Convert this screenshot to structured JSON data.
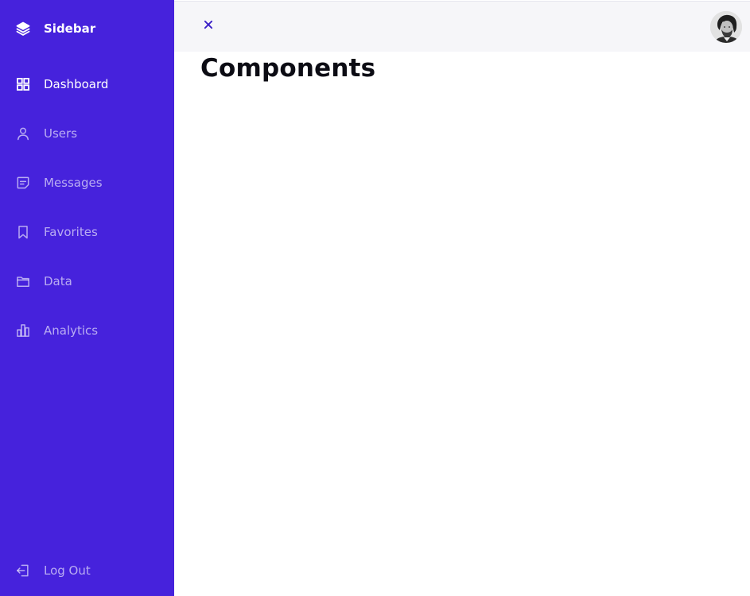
{
  "sidebar": {
    "brand": {
      "label": "Sidebar",
      "icon": "layers-icon"
    },
    "items": [
      {
        "label": "Dashboard",
        "icon": "grid-icon",
        "active": true
      },
      {
        "label": "Users",
        "icon": "user-icon",
        "active": false
      },
      {
        "label": "Messages",
        "icon": "message-icon",
        "active": false
      },
      {
        "label": "Favorites",
        "icon": "bookmark-icon",
        "active": false
      },
      {
        "label": "Data",
        "icon": "folder-icon",
        "active": false
      },
      {
        "label": "Analytics",
        "icon": "bar-chart-icon",
        "active": false
      }
    ],
    "logout": {
      "label": "Log Out",
      "icon": "logout-icon"
    }
  },
  "topbar": {
    "close_icon": "close-icon",
    "avatar": "user-avatar"
  },
  "main": {
    "title": "Components"
  },
  "colors": {
    "sidebar_bg": "#4622dc",
    "topbar_bg": "#f6f6f9",
    "accent": "#3a1fc7",
    "title": "#0c0c14"
  }
}
